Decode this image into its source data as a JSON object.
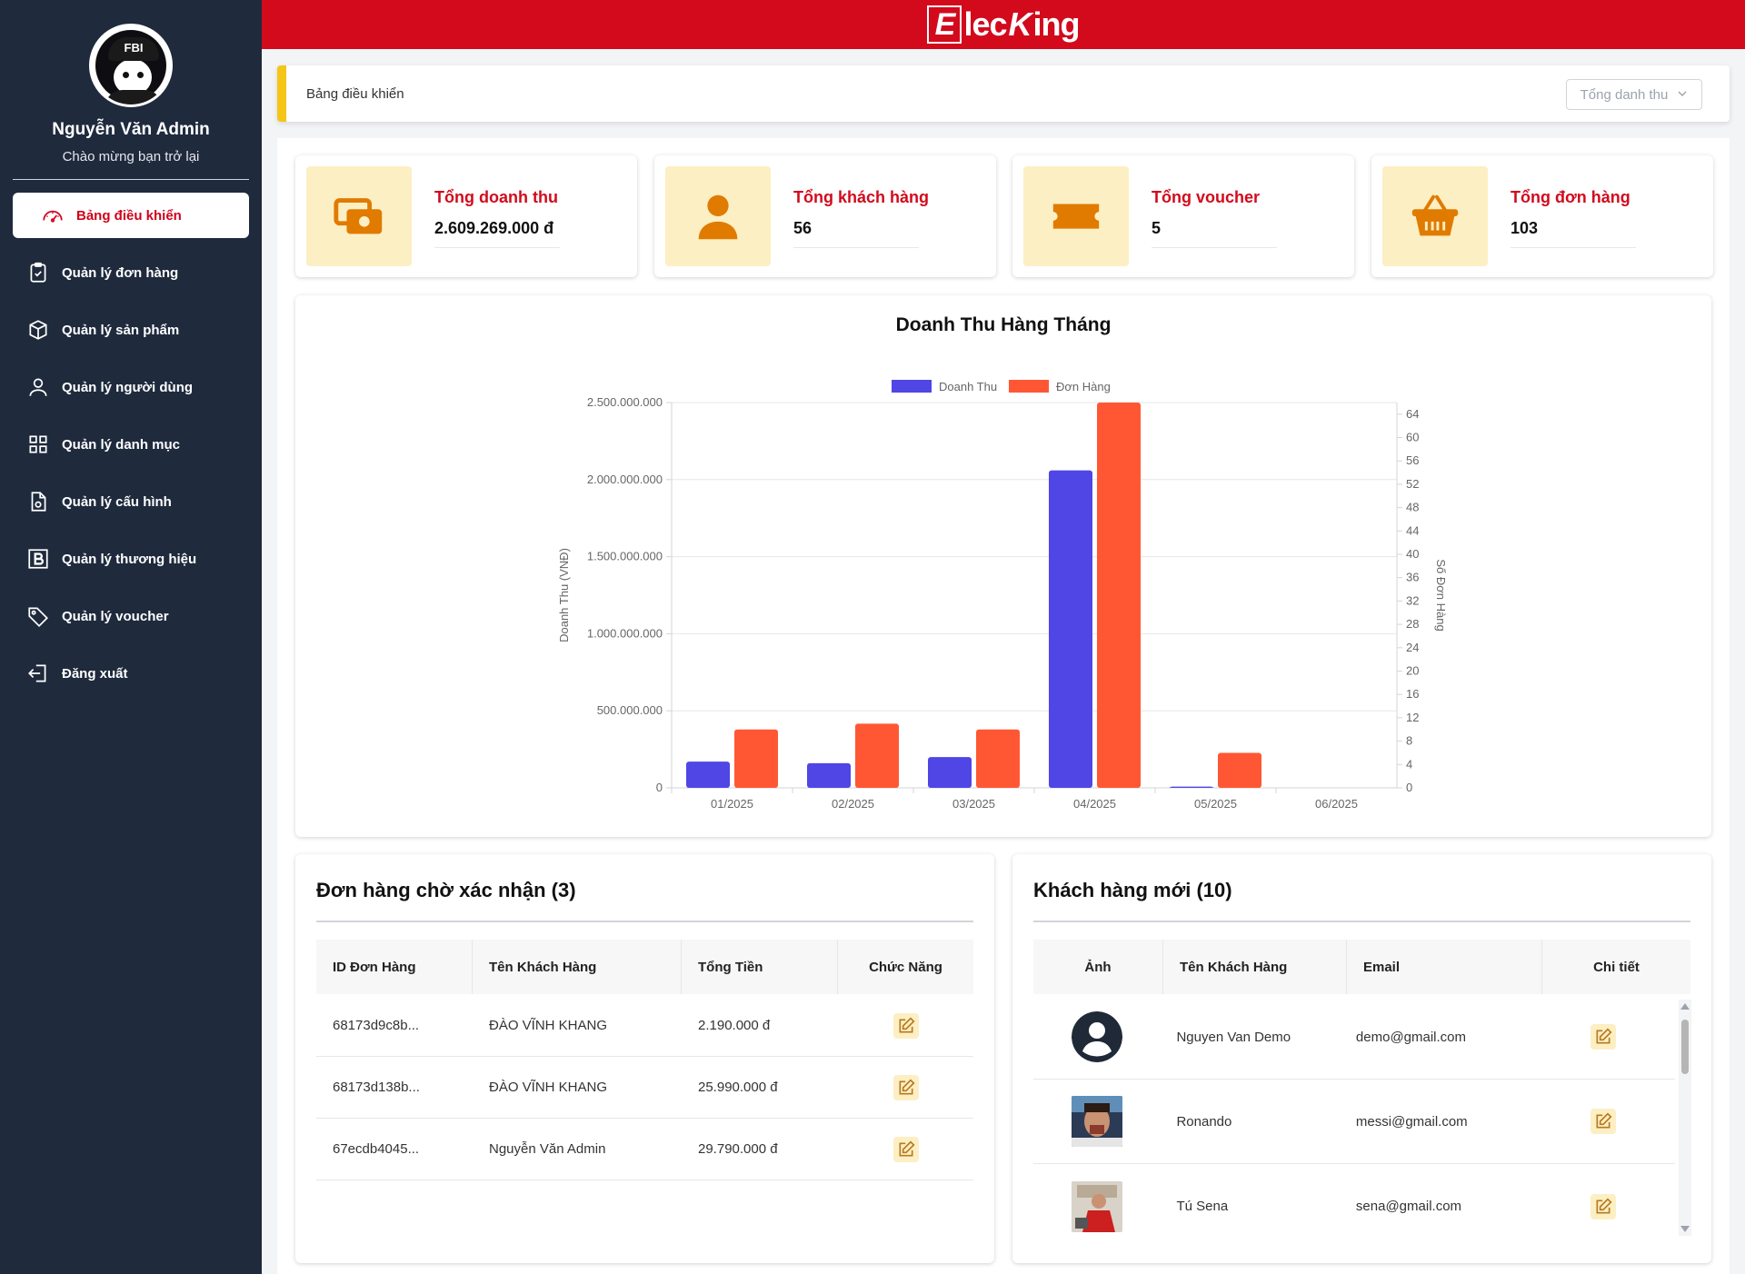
{
  "header": {
    "logo_e": "E",
    "logo_mid": "lec",
    "logo_k": "K",
    "logo_end": "ing"
  },
  "profile": {
    "name": "Nguyễn Văn Admin",
    "subtitle": "Chào mừng bạn trở lại",
    "avatar_text": "FBI"
  },
  "sidebar": {
    "items": [
      {
        "label": "Bảng điều khiển",
        "icon": "speedometer-icon",
        "active": true
      },
      {
        "label": "Quản lý đơn hàng",
        "icon": "clipboard-icon"
      },
      {
        "label": "Quản lý sản phẩm",
        "icon": "box-icon"
      },
      {
        "label": "Quản lý người dùng",
        "icon": "user-icon"
      },
      {
        "label": "Quản lý danh mục",
        "icon": "grid-icon"
      },
      {
        "label": "Quản lý cấu hình",
        "icon": "document-icon"
      },
      {
        "label": "Quản lý thương hiệu",
        "icon": "brand-icon"
      },
      {
        "label": "Quản lý voucher",
        "icon": "tag-icon"
      },
      {
        "label": "Đăng xuất",
        "icon": "logout-icon"
      }
    ]
  },
  "breadcrumb": {
    "title": "Bảng điều khiển",
    "dropdown": "Tổng danh thu"
  },
  "stats": [
    {
      "label": "Tổng doanh thu",
      "value": "2.609.269.000 đ",
      "icon": "money-icon"
    },
    {
      "label": "Tổng khách hàng",
      "value": "56",
      "icon": "person-icon"
    },
    {
      "label": "Tổng voucher",
      "value": "5",
      "icon": "ticket-icon"
    },
    {
      "label": "Tổng đơn hàng",
      "value": "103",
      "icon": "basket-icon"
    }
  ],
  "colors": {
    "red": "#d20a1c",
    "navy": "#1f2a3d",
    "yellow": "#f5c518",
    "revenue": "#4f46e5",
    "orders": "#ff5733",
    "iconOrange": "#e07b00"
  },
  "chart_data": {
    "type": "bar",
    "title": "Doanh Thu Hàng Tháng",
    "categories": [
      "01/2025",
      "02/2025",
      "03/2025",
      "04/2025",
      "05/2025",
      "06/2025"
    ],
    "series": [
      {
        "name": "Doanh Thu",
        "axis": "left",
        "values": [
          170000000,
          160000000,
          200000000,
          2060000000,
          8000000,
          0
        ]
      },
      {
        "name": "Đơn Hàng",
        "axis": "right",
        "values": [
          10,
          11,
          10,
          66,
          6,
          0
        ]
      }
    ],
    "ylabel": "Doanh Thu (VNĐ)",
    "y2label": "Số Đơn Hàng",
    "ylim": [
      0,
      2500000000
    ],
    "y2lim": [
      0,
      66
    ],
    "yticks": [
      "0",
      "500.000.000",
      "1.000.000.000",
      "1.500.000.000",
      "2.000.000.000",
      "2.500.000.000"
    ],
    "y2ticks": [
      "0",
      "4",
      "8",
      "12",
      "16",
      "20",
      "24",
      "28",
      "32",
      "36",
      "40",
      "44",
      "48",
      "52",
      "56",
      "60",
      "64"
    ],
    "legend": "top-center",
    "grid": true
  },
  "orders": {
    "title": "Đơn hàng chờ xác nhận (3)",
    "headers": [
      "ID Đơn Hàng",
      "Tên Khách Hàng",
      "Tổng Tiền",
      "Chức Năng"
    ],
    "rows": [
      {
        "id": "68173d9c8b...",
        "name": "ĐÀO VĨNH KHANG",
        "total": "2.190.000 đ"
      },
      {
        "id": "68173d138b...",
        "name": "ĐÀO VĨNH KHANG",
        "total": "25.990.000 đ"
      },
      {
        "id": "67ecdb4045...",
        "name": "Nguyễn Văn Admin",
        "total": "29.790.000 đ"
      }
    ]
  },
  "customers": {
    "title": "Khách hàng mới (10)",
    "headers": [
      "Ảnh",
      "Tên Khách Hàng",
      "Email",
      "Chi tiết"
    ],
    "rows": [
      {
        "name": "Nguyen Van Demo",
        "email": "demo@gmail.com",
        "avatar": "default-avatar-icon"
      },
      {
        "name": "Ronando",
        "email": "messi@gmail.com",
        "avatar": "photo"
      },
      {
        "name": "Tú Sena",
        "email": "sena@gmail.com",
        "avatar": "photo"
      }
    ]
  }
}
